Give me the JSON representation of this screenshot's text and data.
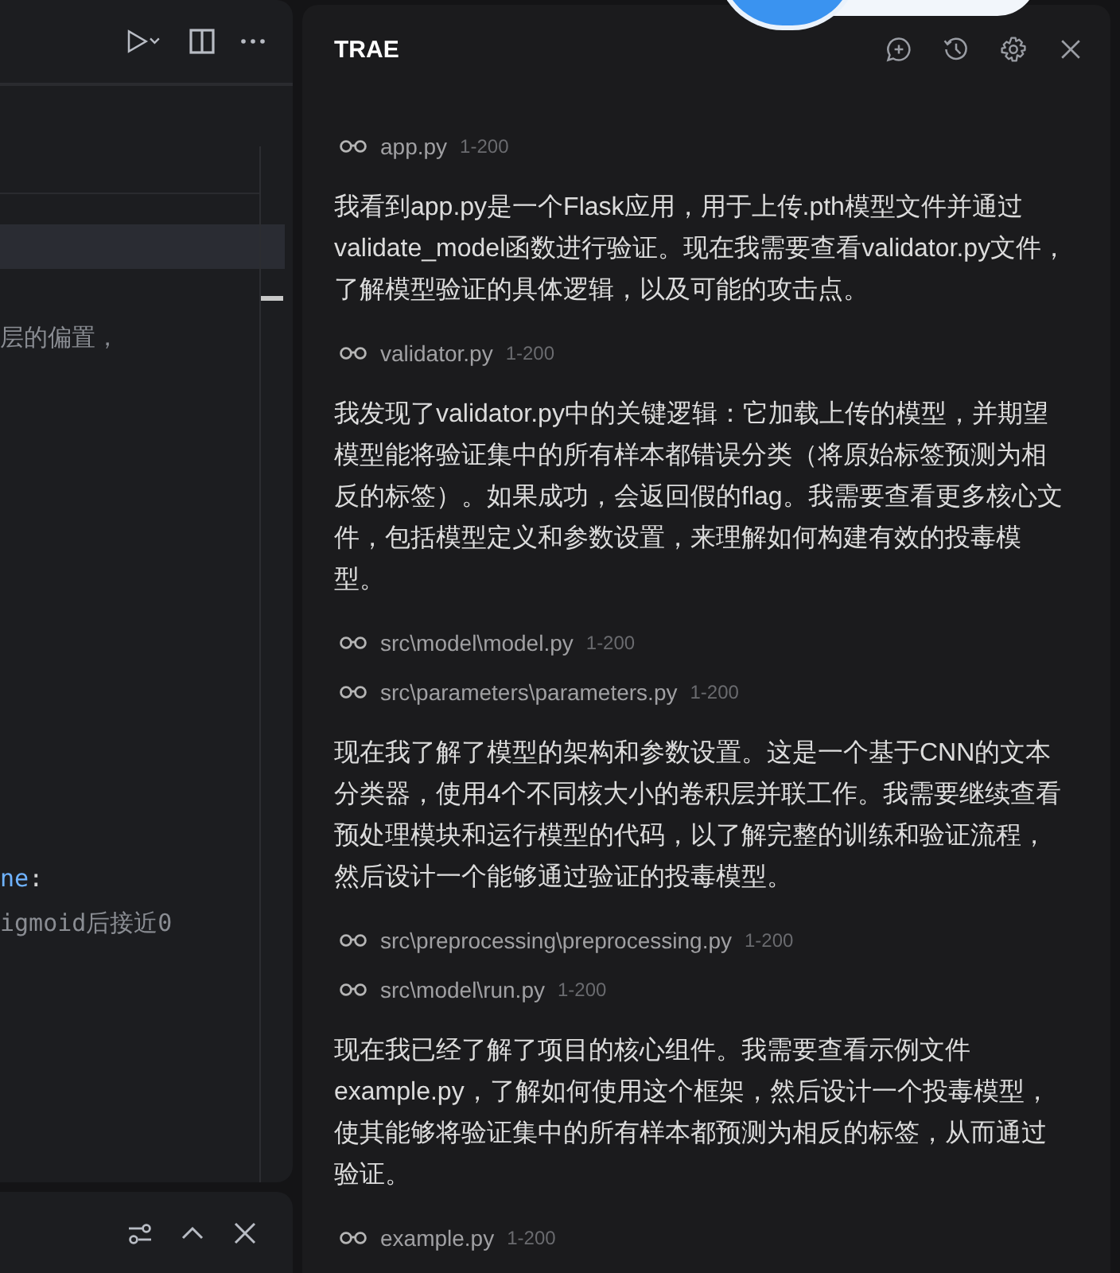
{
  "editor": {
    "code_lines": [
      {
        "segments": [
          {
            "text": "层的偏置，",
            "kind": "comment"
          }
        ]
      },
      {
        "segments": [
          {
            "text": "ne",
            "kind": "keyword"
          },
          {
            "text": ":",
            "kind": "plain"
          }
        ]
      },
      {
        "segments": [
          {
            "text": "igmoid后接近0",
            "kind": "comment"
          }
        ]
      }
    ]
  },
  "chat": {
    "title": "TRAE",
    "items": [
      {
        "kind": "file",
        "name": "app.py",
        "range": "1-200"
      },
      {
        "kind": "message",
        "text": "我看到app.py是一个Flask应用，用于上传.pth模型文件并通过validate_model函数进行验证。现在我需要查看validator.py文件，了解模型验证的具体逻辑，以及可能的攻击点。"
      },
      {
        "kind": "file",
        "name": "validator.py",
        "range": "1-200"
      },
      {
        "kind": "message",
        "text": "我发现了validator.py中的关键逻辑：它加载上传的模型，并期望模型能将验证集中的所有样本都错误分类（将原始标签预测为相反的标签）。如果成功，会返回假的flag。我需要查看更多核心文件，包括模型定义和参数设置，来理解如何构建有效的投毒模型。"
      },
      {
        "kind": "file",
        "name": "src\\model\\model.py",
        "range": "1-200"
      },
      {
        "kind": "file",
        "name": "src\\parameters\\parameters.py",
        "range": "1-200"
      },
      {
        "kind": "message",
        "text": "现在我了解了模型的架构和参数设置。这是一个基于CNN的文本分类器，使用4个不同核大小的卷积层并联工作。我需要继续查看预处理模块和运行模型的代码，以了解完整的训练和验证流程，然后设计一个能够通过验证的投毒模型。"
      },
      {
        "kind": "file",
        "name": "src\\preprocessing\\preprocessing.py",
        "range": "1-200"
      },
      {
        "kind": "file",
        "name": "src\\model\\run.py",
        "range": "1-200"
      },
      {
        "kind": "message",
        "text": "现在我已经了解了项目的核心组件。我需要查看示例文件example.py，了解如何使用这个框架，然后设计一个投毒模型，使其能够将验证集中的所有样本都预测为相反的标签，从而通过验证。"
      },
      {
        "kind": "file",
        "name": "example.py",
        "range": "1-200"
      }
    ]
  }
}
